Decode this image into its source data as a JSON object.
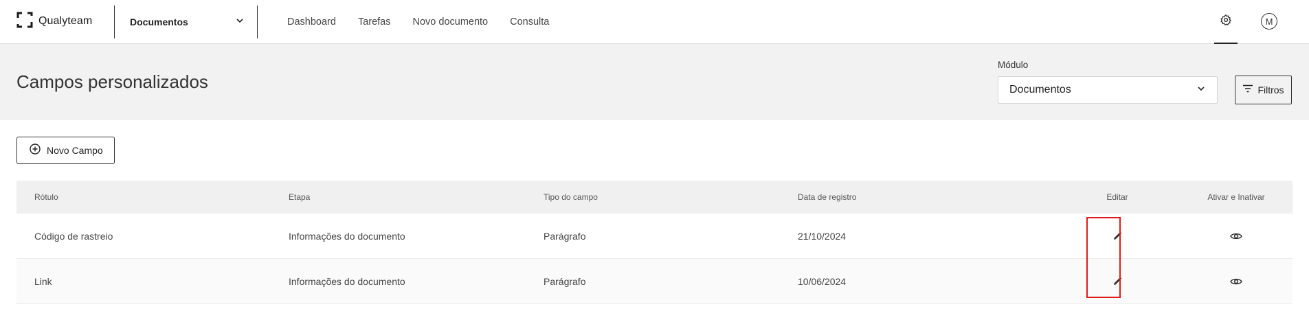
{
  "app": {
    "brand": "Qualyteam",
    "module": "Documentos"
  },
  "nav": [
    "Dashboard",
    "Tarefas",
    "Novo documento",
    "Consulta"
  ],
  "user": {
    "initial": "M"
  },
  "page": {
    "title": "Campos personalizados",
    "modulo_label": "Módulo",
    "modulo_value": "Documentos",
    "filtros_label": "Filtros",
    "novo_campo_label": "Novo Campo"
  },
  "table": {
    "headers": [
      "Rótulo",
      "Etapa",
      "Tipo do campo",
      "Data de registro",
      "Editar",
      "Ativar e Inativar"
    ],
    "rows": [
      {
        "rotulo": "Código de rastreio",
        "etapa": "Informações do documento",
        "tipo": "Parágrafo",
        "data": "21/10/2024"
      },
      {
        "rotulo": "Link",
        "etapa": "Informações do documento",
        "tipo": "Parágrafo",
        "data": "10/06/2024"
      }
    ]
  },
  "icons": {
    "logo": "qualyteam-logo-icon",
    "chevron": "chevron-down-icon",
    "settings": "gear-icon",
    "filter": "filter-icon",
    "add": "add-circle-icon",
    "edit": "pencil-icon",
    "visibility": "eye-icon"
  },
  "colors": {
    "highlight": "#e01b1b",
    "header_band": "#f2f2f2"
  }
}
